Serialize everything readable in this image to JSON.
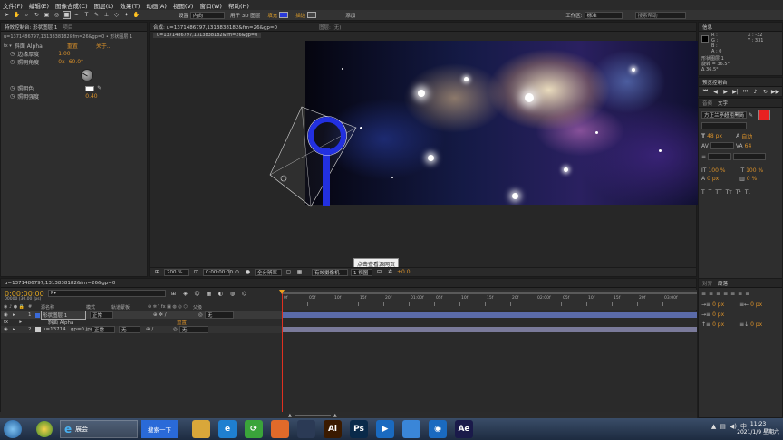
{
  "menu": [
    "文件(F)",
    "编辑(E)",
    "图像合成(C)",
    "图层(L)",
    "效果(T)",
    "动画(A)",
    "视图(V)",
    "窗口(W)",
    "帮助(H)"
  ],
  "toolbar": {
    "settings_label": "设置",
    "settings_value": "内向",
    "apply3d": "用于 3D 图层",
    "fill_label": "填充",
    "stroke_label": "描边",
    "add_label": "添加",
    "workspace_label": "工作区:",
    "workspace_value": "标准",
    "search_placeholder": "搜索帮助"
  },
  "left_panel": {
    "tabs": [
      "特效控制台: 形状图层 1",
      "项目"
    ],
    "source": "u=1371486797,1313838182&fm=26&gp=0 • 形状图层 1",
    "effect_name": "斜面 Alpha",
    "reset": "重置",
    "about": "关于...",
    "properties": [
      {
        "name": "边缘厚度",
        "value": "1.00"
      },
      {
        "name": "照明角度",
        "value": "0x -60.0°"
      },
      {
        "name": "照明色",
        "value": ""
      },
      {
        "name": "照明强度",
        "value": "0.40"
      }
    ]
  },
  "comp_panel": {
    "tabs": [
      "合成: u=1371486797,1313838182&fm=26&gp=0",
      "图层: (无)"
    ],
    "subtab": "u=1371486797,1313838182&fm=26&gp=0",
    "tooltip": "点击查看源网页",
    "footer": {
      "zoom": "200 %",
      "timecode": "0:00:00:00",
      "resolution": "全分辨率",
      "camera": "有效摄像机",
      "views": "1 视图",
      "exposure": "+0.0"
    }
  },
  "info_panel": {
    "tabs": [
      "信息"
    ],
    "rgba": [
      "R :",
      "G :",
      "B :",
      "A : 0"
    ],
    "coords": [
      "X : -32",
      "Y : 331"
    ],
    "lines": [
      "形状图层 1",
      "旋转 = 36.5°",
      "Δ 36.5°"
    ]
  },
  "preview_panel": {
    "tabs": [
      "预览控制台"
    ]
  },
  "char_panel": {
    "tabs": [
      "音频",
      "文字"
    ],
    "font": "方正兰亭超粗黑简",
    "font_size": "48 px",
    "leading": "自动",
    "tracking": "64",
    "scale_v": "100 %",
    "scale_h": "100 %",
    "baseline": "0 px",
    "tsume": "0 %"
  },
  "align_panel": {
    "tabs": [
      "对齐",
      "段落"
    ],
    "values": [
      "0 px",
      "0 px",
      "0 px",
      "0 px",
      "0 px"
    ]
  },
  "timeline": {
    "tab": "u=1371486797,1313838182&fm=26&gp=0",
    "timecode": "0:00:00:00",
    "timecode_sub": "00000 (30.00 fps)",
    "search_placeholder": "P▾",
    "col_source": "源名称",
    "col_mode": "模式",
    "col_trkmat": "轨道蒙板",
    "col_parent": "父级",
    "layers": [
      {
        "num": "1",
        "name": "形状图层 1",
        "mode": "正常",
        "trkmat": "",
        "parent": "无"
      },
      {
        "num": "",
        "name": "斜面 Alpha",
        "mode": "重置",
        "trkmat": "",
        "parent": ""
      },
      {
        "num": "2",
        "name": "u=13714...gp=0.jpg",
        "mode": "正常",
        "trkmat": "无",
        "parent": "无"
      }
    ],
    "ruler": [
      "0f",
      "05f",
      "10f",
      "15f",
      "20f",
      "01:00f",
      "05f",
      "10f",
      "15f",
      "20f",
      "02:00f",
      "05f",
      "10f",
      "15f",
      "20f",
      "03:00f"
    ]
  },
  "taskbar": {
    "ie_label": "展会",
    "search_label": "搜索一下",
    "time": "11:23",
    "date": "2021/1/9 星期六",
    "apps": [
      {
        "name": "folder",
        "label": "",
        "color": "#d9a73a"
      },
      {
        "name": "edge",
        "label": "e",
        "color": "#1f7fd0"
      },
      {
        "name": "360",
        "label": "⟳",
        "color": "#3aa43a"
      },
      {
        "name": "photos",
        "label": "",
        "color": "#e06a2a"
      },
      {
        "name": "c4d",
        "label": "",
        "color": "#2b3a55"
      },
      {
        "name": "illustrator",
        "label": "Ai",
        "color": "#3a1a00"
      },
      {
        "name": "photoshop",
        "label": "Ps",
        "color": "#0a2a4a"
      },
      {
        "name": "video",
        "label": "▶",
        "color": "#1a6ac0"
      },
      {
        "name": "feishu",
        "label": "",
        "color": "#3a86d8"
      },
      {
        "name": "camera",
        "label": "◉",
        "color": "#1a6ac0"
      },
      {
        "name": "after-effects",
        "label": "Ae",
        "color": "#1a1a4a"
      }
    ]
  }
}
